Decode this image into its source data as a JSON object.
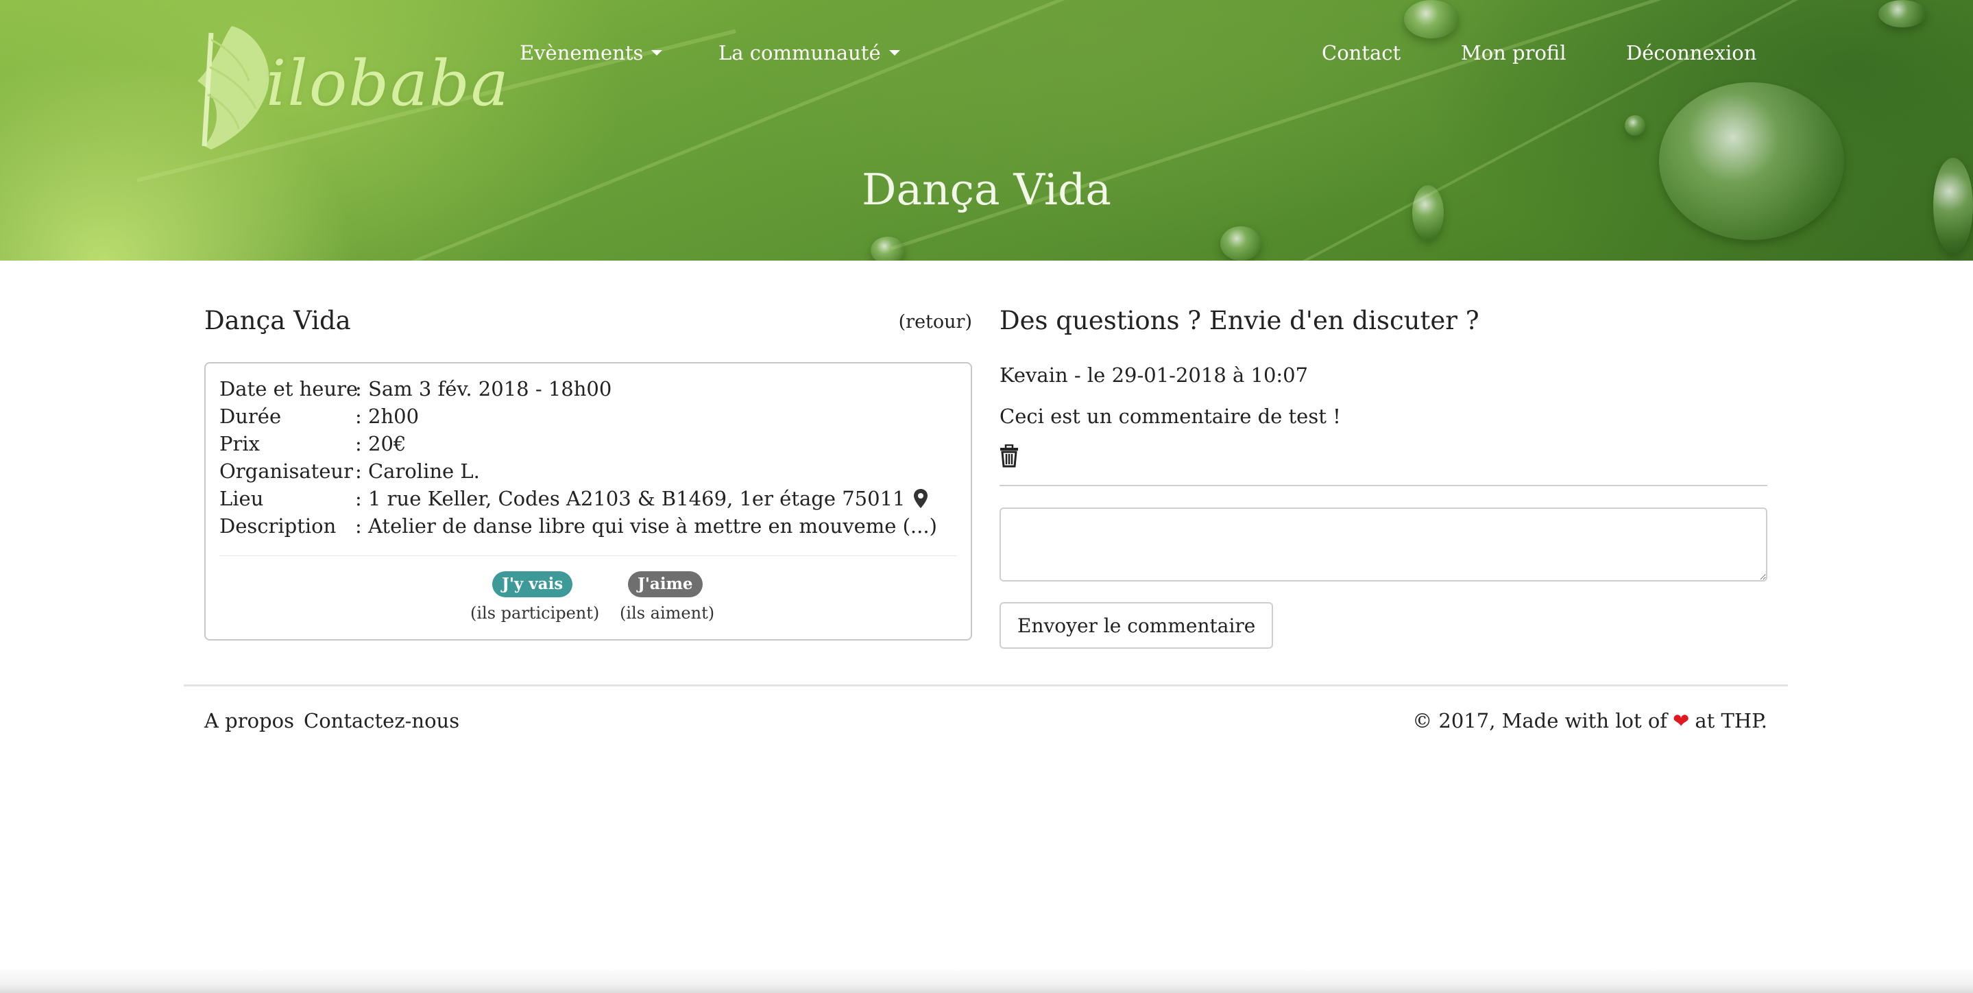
{
  "brand": {
    "logo_text": "ilobaba"
  },
  "nav": {
    "left": [
      {
        "label": "Evènements",
        "has_dropdown": true
      },
      {
        "label": "La communauté",
        "has_dropdown": true
      }
    ],
    "right": [
      {
        "label": "Contact"
      },
      {
        "label": "Mon profil"
      },
      {
        "label": "Déconnexion"
      }
    ]
  },
  "hero": {
    "title": "Dança Vida"
  },
  "event": {
    "title": "Dança Vida",
    "back_label": "(retour)",
    "details": [
      {
        "label": "Date et heure",
        "value": ": Sam 3 fév. 2018 - 18h00"
      },
      {
        "label": "Durée",
        "value": ": 2h00"
      },
      {
        "label": "Prix",
        "value": ": 20€"
      },
      {
        "label": "Organisateur",
        "value": ": Caroline L."
      },
      {
        "label": "Lieu",
        "value": ": 1 rue Keller, Codes A2103 & B1469, 1er étage 75011"
      },
      {
        "label": "Description",
        "value": ": Atelier de danse libre qui vise à mettre en mouveme (...)"
      }
    ],
    "actions": {
      "going": {
        "label": "J'y vais",
        "caption": "(ils participent)",
        "color": "#3d9a99"
      },
      "like": {
        "label": "J'aime",
        "caption": "(ils aiment)",
        "color": "#6f6f6f"
      }
    }
  },
  "comments": {
    "heading": "Des questions ? Envie d'en discuter ?",
    "items": [
      {
        "meta": "Kevain - le 29-01-2018 à 10:07",
        "body": "Ceci est un commentaire de test !"
      }
    ],
    "input_value": "",
    "submit_label": "Envoyer le commentaire"
  },
  "footer": {
    "links": [
      {
        "label": "A propos"
      },
      {
        "label": "Contactez-nous"
      }
    ],
    "copyright_prefix": "© 2017, Made with lot of",
    "heart": "❤",
    "copyright_suffix": "at THP."
  },
  "icons": {
    "dropdown": "caret-down-icon",
    "location": "map-marker-icon",
    "delete": "trash-icon",
    "heart": "heart-icon"
  },
  "colors": {
    "accent_teal": "#3d9a99",
    "badge_grey": "#6f6f6f",
    "heart_red": "#e0181f"
  }
}
